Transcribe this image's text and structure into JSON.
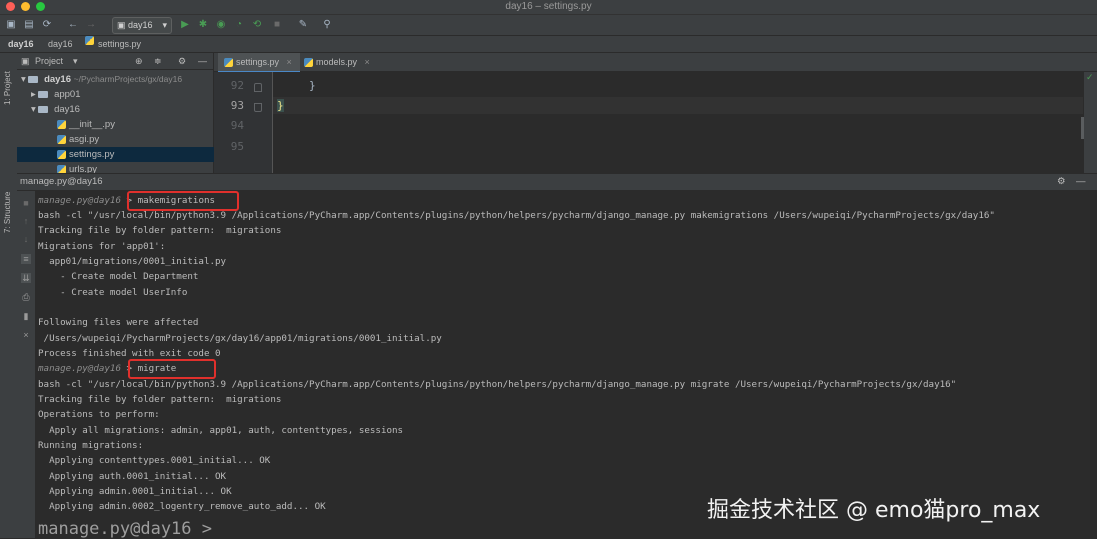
{
  "window": {
    "title": "day16 – settings.py"
  },
  "toolbar": {
    "run_config": "day16"
  },
  "breadcrumb": [
    "day16",
    "day16",
    "settings.py"
  ],
  "left_strip": {
    "project_label": "1: Project",
    "structure_label": "7: Structure"
  },
  "project_panel": {
    "title": "Project",
    "tree": [
      {
        "label": "day16",
        "path": "~/PycharmProjects/gx/day16",
        "kind": "folder",
        "expanded": true
      },
      {
        "label": "app01",
        "kind": "folder",
        "expanded": false
      },
      {
        "label": "day16",
        "kind": "folder",
        "expanded": true
      },
      {
        "label": "__init__.py",
        "kind": "file"
      },
      {
        "label": "asgi.py",
        "kind": "file"
      },
      {
        "label": "settings.py",
        "kind": "file",
        "selected": true
      },
      {
        "label": "urls.py",
        "kind": "file"
      }
    ]
  },
  "editor": {
    "tabs": [
      {
        "label": "settings.py",
        "active": true
      },
      {
        "label": "models.py",
        "active": false
      }
    ],
    "lines": [
      {
        "number": "92",
        "code": "}"
      },
      {
        "number": "93",
        "code": "}"
      },
      {
        "number": "94",
        "code": ""
      },
      {
        "number": "95",
        "code": ""
      }
    ]
  },
  "run_panel": {
    "title": "manage.py@day16",
    "console": [
      {
        "prompt": "manage.py@day16",
        "command": "> makemigrations"
      },
      {
        "text": "bash -cl \"/usr/local/bin/python3.9 /Applications/PyCharm.app/Contents/plugins/python/helpers/pycharm/django_manage.py makemigrations /Users/wupeiqi/PycharmProjects/gx/day16\""
      },
      {
        "text": "Tracking file by folder pattern:  migrations"
      },
      {
        "text": "Migrations for 'app01':"
      },
      {
        "text": "  app01/migrations/0001_initial.py"
      },
      {
        "text": "    - Create model Department"
      },
      {
        "text": "    - Create model UserInfo"
      },
      {
        "text": ""
      },
      {
        "text": "Following files were affected"
      },
      {
        "text": " /Users/wupeiqi/PycharmProjects/gx/day16/app01/migrations/0001_initial.py"
      },
      {
        "text": "Process finished with exit code 0"
      },
      {
        "prompt": "manage.py@day16",
        "command": "> migrate"
      },
      {
        "text": "bash -cl \"/usr/local/bin/python3.9 /Applications/PyCharm.app/Contents/plugins/python/helpers/pycharm/django_manage.py migrate /Users/wupeiqi/PycharmProjects/gx/day16\""
      },
      {
        "text": "Tracking file by folder pattern:  migrations"
      },
      {
        "text": "Operations to perform:"
      },
      {
        "text": "  Apply all migrations: admin, app01, auth, contenttypes, sessions"
      },
      {
        "text": "Running migrations:"
      },
      {
        "text": "  Applying contenttypes.0001_initial... OK"
      },
      {
        "text": "  Applying auth.0001_initial... OK"
      },
      {
        "text": "  Applying admin.0001_initial... OK"
      },
      {
        "text": "  Applying admin.0002_logentry_remove_auto_add... OK"
      }
    ],
    "current_prompt": "manage.py@day16 >"
  },
  "watermark": "掘金技术社区 @ emo猫pro_max",
  "colors": {
    "highlight": "#e0302c",
    "selection": "#0d293e",
    "run": "#499c54"
  }
}
